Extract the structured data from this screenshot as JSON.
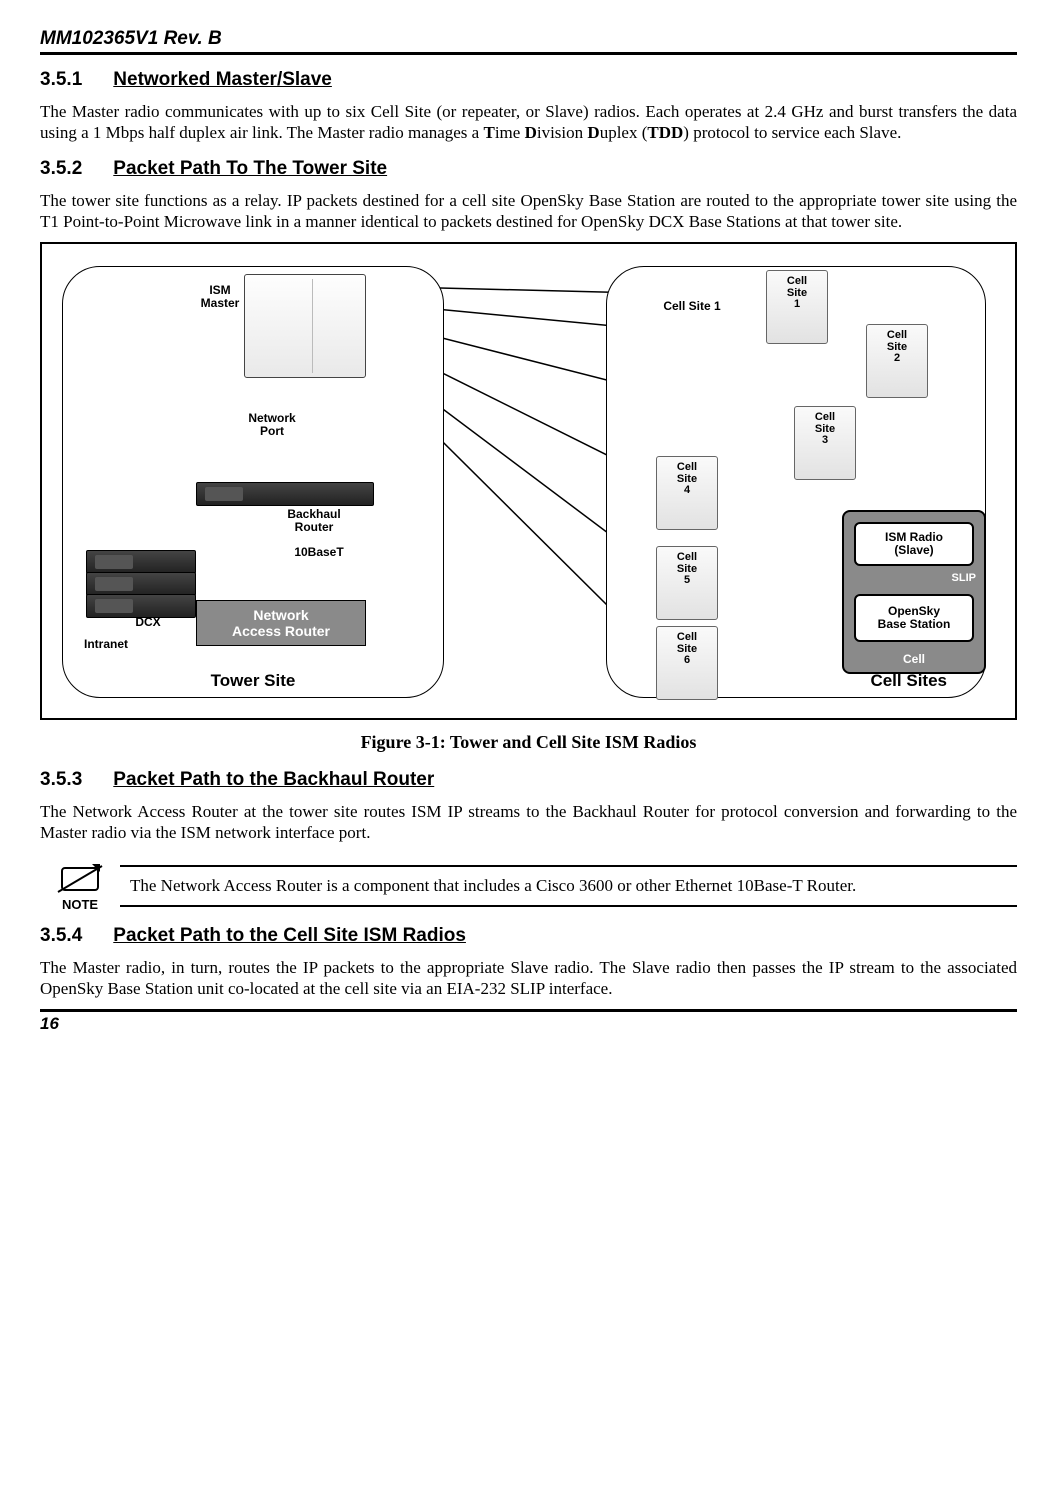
{
  "header": "MM102365V1 Rev. B",
  "page_number": "16",
  "sections": {
    "s1": {
      "num": "3.5.1",
      "title": "Networked Master/Slave",
      "para": "The Master radio communicates with up to six Cell Site (or repeater, or Slave) radios. Each operates at 2.4 GHz and burst transfers the data using a 1 Mbps half duplex air link. The Master radio manages a Time Division Duplex (TDD) protocol to service each Slave."
    },
    "s2": {
      "num": "3.5.2",
      "title": "Packet Path To The Tower Site",
      "para": "The tower site functions as a relay. IP packets destined for a cell site OpenSky Base Station are routed to the appropriate tower site using the T1 Point-to-Point Microwave link in a manner identical to packets destined for OpenSky DCX Base Stations at that tower site."
    },
    "s3": {
      "num": "3.5.3",
      "title": "Packet Path to the Backhaul Router",
      "para": "The Network Access Router at the tower site routes ISM IP streams to the Backhaul Router for protocol conversion and forwarding to the Master radio via the ISM network interface port."
    },
    "s4": {
      "num": "3.5.4",
      "title": "Packet Path to the Cell Site ISM Radios",
      "para": "The Master radio, in turn, routes the IP packets to the appropriate Slave radio. The Slave radio then passes the IP stream to the associated OpenSky Base Station unit co-located at the cell site via an EIA-232 SLIP interface."
    }
  },
  "figure": {
    "caption": "Figure 3-1: Tower and Cell Site ISM Radios",
    "tower_title": "Tower Site",
    "sites_title": "Cell Sites",
    "labels": {
      "ism_master": "ISM\nMaster",
      "network_port": "Network\nPort",
      "backhaul_router": "Backhaul\nRouter",
      "ten_base_t": "10BaseT",
      "dcx": "DCX",
      "intranet": "Intranet",
      "nar": "Network\nAccess Router",
      "cell_site_1_label": "Cell Site 1",
      "ism_radio_slave": "ISM Radio\n(Slave)",
      "slip": "SLIP",
      "opensky_bs": "OpenSky\nBase Station",
      "cell": "Cell"
    },
    "cells": {
      "c1": "Cell\nSite\n1",
      "c2": "Cell\nSite\n2",
      "c3": "Cell\nSite\n3",
      "c4": "Cell\nSite\n4",
      "c5": "Cell\nSite\n5",
      "c6": "Cell\nSite\n6"
    }
  },
  "note": {
    "label": "NOTE",
    "text": "The Network Access Router is a component that includes a Cisco 3600 or other Ethernet 10Base-T Router."
  }
}
